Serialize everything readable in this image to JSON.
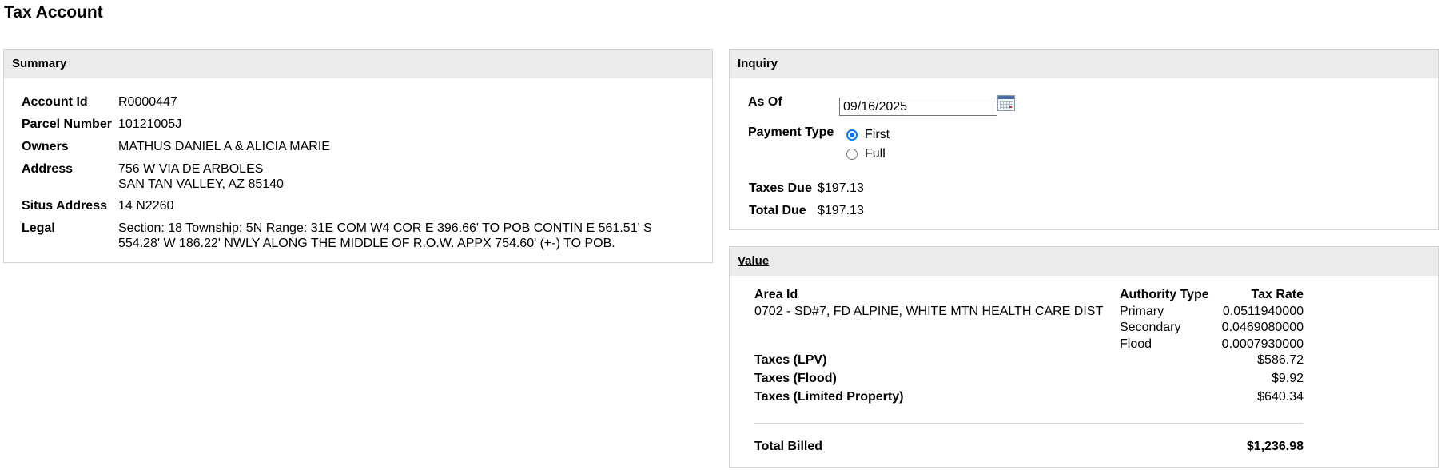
{
  "page": {
    "title": "Tax Account"
  },
  "summary": {
    "header": "Summary",
    "rows": [
      {
        "label": "Account Id",
        "value": "R0000447"
      },
      {
        "label": "Parcel Number",
        "value": "10121005J"
      },
      {
        "label": "Owners",
        "value": "MATHUS DANIEL A & ALICIA MARIE"
      },
      {
        "label": "Address",
        "value_line1": "756 W VIA DE ARBOLES",
        "value_line2": "SAN TAN VALLEY, AZ 85140"
      },
      {
        "label": "Situs Address",
        "value": "14 N2260"
      },
      {
        "label": "Legal",
        "value_line1": "Section: 18 Township: 5N Range: 31E COM W4 COR E 396.66' TO POB CONTIN E 561.51' S",
        "value_line2": "554.28' W 186.22' NWLY ALONG THE MIDDLE OF R.O.W. APPX 754.60' (+-) TO POB."
      }
    ]
  },
  "inquiry": {
    "header": "Inquiry",
    "as_of_label": "As Of",
    "as_of_value": "09/16/2025",
    "calendar_icon": "calendar-icon",
    "payment_type_label": "Payment Type",
    "payment_options": [
      {
        "label": "First",
        "checked": true
      },
      {
        "label": "Full",
        "checked": false
      }
    ],
    "taxes_due_label": "Taxes Due",
    "taxes_due_value": "$197.13",
    "total_due_label": "Total Due",
    "total_due_value": "$197.13"
  },
  "value": {
    "header": "Value",
    "columns": {
      "area_id": "Area Id",
      "authority_type": "Authority Type",
      "tax_rate": "Tax Rate"
    },
    "area": "0702 - SD#7, FD ALPINE, WHITE MTN HEALTH CARE DIST",
    "authorities": [
      {
        "type": "Primary",
        "rate": "0.0511940000"
      },
      {
        "type": "Secondary",
        "rate": "0.0469080000"
      },
      {
        "type": "Flood",
        "rate": "0.0007930000"
      }
    ],
    "taxes": [
      {
        "label": "Taxes (LPV)",
        "amount": "$586.72"
      },
      {
        "label": "Taxes (Flood)",
        "amount": "$9.92"
      },
      {
        "label": "Taxes (Limited Property)",
        "amount": "$640.34"
      }
    ],
    "total_billed_label": "Total Billed",
    "total_billed_value": "$1,236.98"
  },
  "colors": {
    "header_bg": "#ececec",
    "border": "#d2d2d2",
    "radio_accent": "#0075ff"
  }
}
